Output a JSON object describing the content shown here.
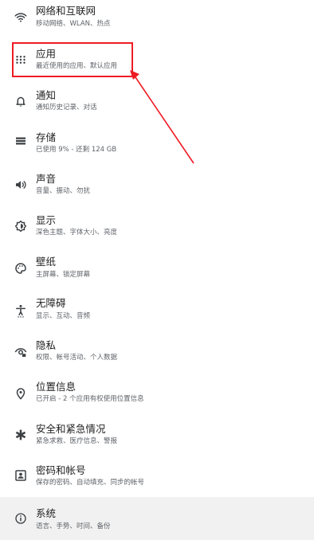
{
  "settings": {
    "items": [
      {
        "title": "网络和互联网",
        "subtitle": "移动网络、WLAN、热点",
        "icon": "wifi-icon"
      },
      {
        "title": "应用",
        "subtitle": "最近使用的应用、默认应用",
        "icon": "apps-grid-icon"
      },
      {
        "title": "通知",
        "subtitle": "通知历史记录、对话",
        "icon": "bell-icon"
      },
      {
        "title": "存储",
        "subtitle": "已使用 9% - 还剩 124 GB",
        "icon": "storage-icon"
      },
      {
        "title": "声音",
        "subtitle": "音量、振动、勿扰",
        "icon": "volume-icon"
      },
      {
        "title": "显示",
        "subtitle": "深色主题、字体大小、亮度",
        "icon": "brightness-icon"
      },
      {
        "title": "壁纸",
        "subtitle": "主屏幕、锁定屏幕",
        "icon": "palette-icon"
      },
      {
        "title": "无障碍",
        "subtitle": "显示、互动、音频",
        "icon": "accessibility-icon"
      },
      {
        "title": "隐私",
        "subtitle": "权限、帐号活动、个人数据",
        "icon": "privacy-eye-icon"
      },
      {
        "title": "位置信息",
        "subtitle": "已开启 - 2 个应用有权使用位置信息",
        "icon": "location-pin-icon"
      },
      {
        "title": "安全和紧急情况",
        "subtitle": "紧急求救、医疗信息、警报",
        "icon": "emergency-icon"
      },
      {
        "title": "密码和帐号",
        "subtitle": "保存的密码、自动填充、同步的帐号",
        "icon": "account-box-icon"
      },
      {
        "title": "系统",
        "subtitle": "语言、手势、时间、备份",
        "icon": "info-icon"
      }
    ]
  },
  "annotation": {
    "color": "#ee1c24",
    "highlighted_item": "应用"
  },
  "colors": {
    "title": "#1f1f1f",
    "subtitle": "#5f6368",
    "icon": "#3c4043",
    "selected_row_bg": "#f1f1f1"
  }
}
